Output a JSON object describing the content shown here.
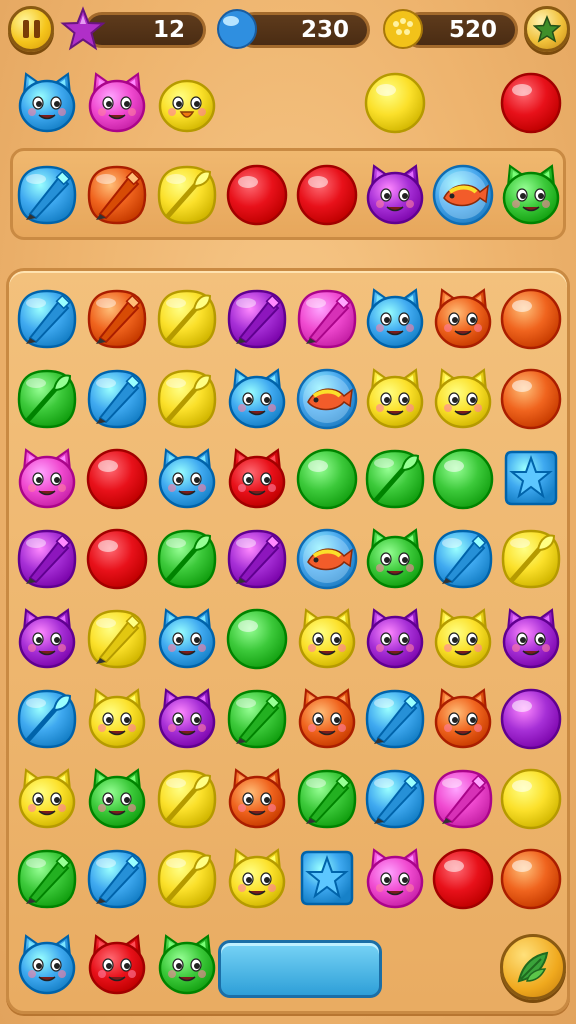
{
  "hud": {
    "stars": "12",
    "gems": "230",
    "coins": "520"
  },
  "preview_row": [
    {
      "kind": "cat",
      "color": "blue"
    },
    {
      "kind": "cat",
      "color": "pink"
    },
    {
      "kind": "chick",
      "color": "yellow"
    },
    {
      "kind": "empty"
    },
    {
      "kind": "empty"
    },
    {
      "kind": "ball",
      "color": "yellow"
    },
    {
      "kind": "empty"
    },
    {
      "kind": "ball",
      "color": "red"
    }
  ],
  "queue_row": [
    {
      "kind": "pen",
      "color": "blue"
    },
    {
      "kind": "pen",
      "color": "orange"
    },
    {
      "kind": "brush",
      "color": "yellow"
    },
    {
      "kind": "ball",
      "color": "red"
    },
    {
      "kind": "ball",
      "color": "red"
    },
    {
      "kind": "cat",
      "color": "purple"
    },
    {
      "kind": "fish",
      "color": "sky"
    },
    {
      "kind": "cat",
      "color": "green"
    }
  ],
  "board": [
    [
      {
        "kind": "pen",
        "color": "blue"
      },
      {
        "kind": "pen",
        "color": "orange"
      },
      {
        "kind": "brush",
        "color": "yellow"
      },
      {
        "kind": "pen",
        "color": "purple"
      },
      {
        "kind": "pen",
        "color": "pink"
      },
      {
        "kind": "cat",
        "color": "blue"
      },
      {
        "kind": "cat",
        "color": "orange"
      },
      {
        "kind": "ball",
        "color": "orange"
      }
    ],
    [
      {
        "kind": "brush",
        "color": "green"
      },
      {
        "kind": "pen",
        "color": "blue"
      },
      {
        "kind": "brush",
        "color": "yellow"
      },
      {
        "kind": "cat",
        "color": "blue"
      },
      {
        "kind": "fish",
        "color": "sky"
      },
      {
        "kind": "cat",
        "color": "yellow"
      },
      {
        "kind": "cat",
        "color": "yellow"
      },
      {
        "kind": "ball",
        "color": "orange"
      }
    ],
    [
      {
        "kind": "cat",
        "color": "pink"
      },
      {
        "kind": "ball",
        "color": "red"
      },
      {
        "kind": "cat",
        "color": "blue"
      },
      {
        "kind": "cat",
        "color": "red"
      },
      {
        "kind": "ball",
        "color": "green"
      },
      {
        "kind": "brush",
        "color": "green"
      },
      {
        "kind": "ball",
        "color": "green"
      },
      {
        "kind": "star",
        "color": "blue"
      }
    ],
    [
      {
        "kind": "pen",
        "color": "purple"
      },
      {
        "kind": "ball",
        "color": "red"
      },
      {
        "kind": "brush",
        "color": "green"
      },
      {
        "kind": "pen",
        "color": "purple"
      },
      {
        "kind": "fish",
        "color": "sky"
      },
      {
        "kind": "cat",
        "color": "green"
      },
      {
        "kind": "pen",
        "color": "blue"
      },
      {
        "kind": "brush",
        "color": "yellow"
      }
    ],
    [
      {
        "kind": "cat",
        "color": "purple"
      },
      {
        "kind": "pen",
        "color": "yellow"
      },
      {
        "kind": "cat",
        "color": "blue"
      },
      {
        "kind": "ball",
        "color": "green"
      },
      {
        "kind": "cat",
        "color": "yellow"
      },
      {
        "kind": "cat",
        "color": "purple"
      },
      {
        "kind": "cat",
        "color": "yellow"
      },
      {
        "kind": "cat",
        "color": "purple"
      }
    ],
    [
      {
        "kind": "brush",
        "color": "blue"
      },
      {
        "kind": "cat",
        "color": "yellow"
      },
      {
        "kind": "cat",
        "color": "purple"
      },
      {
        "kind": "pen",
        "color": "green"
      },
      {
        "kind": "cat",
        "color": "orange"
      },
      {
        "kind": "pen",
        "color": "blue"
      },
      {
        "kind": "cat",
        "color": "orange"
      },
      {
        "kind": "ball",
        "color": "purple"
      }
    ],
    [
      {
        "kind": "cat",
        "color": "yellow"
      },
      {
        "kind": "cat",
        "color": "green"
      },
      {
        "kind": "brush",
        "color": "yellow"
      },
      {
        "kind": "cat",
        "color": "orange"
      },
      {
        "kind": "pen",
        "color": "green"
      },
      {
        "kind": "pen",
        "color": "blue"
      },
      {
        "kind": "pen",
        "color": "pink"
      },
      {
        "kind": "ball",
        "color": "yellow"
      }
    ],
    [
      {
        "kind": "pen",
        "color": "green"
      },
      {
        "kind": "pen",
        "color": "blue"
      },
      {
        "kind": "brush",
        "color": "yellow"
      },
      {
        "kind": "cat",
        "color": "yellow"
      },
      {
        "kind": "star",
        "color": "blue"
      },
      {
        "kind": "cat",
        "color": "pink"
      },
      {
        "kind": "ball",
        "color": "red"
      },
      {
        "kind": "ball",
        "color": "orange"
      }
    ]
  ],
  "bottom_row": [
    {
      "kind": "cat",
      "color": "blue"
    },
    {
      "kind": "cat",
      "color": "red"
    },
    {
      "kind": "cat",
      "color": "green"
    }
  ],
  "palette": {
    "blue": "#3fa9f0",
    "orange": "#f0641e",
    "yellow": "#fbe02a",
    "purple": "#a62fd6",
    "pink": "#f04ad0",
    "red": "#e8111a",
    "green": "#3cc93a",
    "sky": "#4aa8ee",
    "panel": "#eeb46e",
    "frame": "#c98a43"
  }
}
